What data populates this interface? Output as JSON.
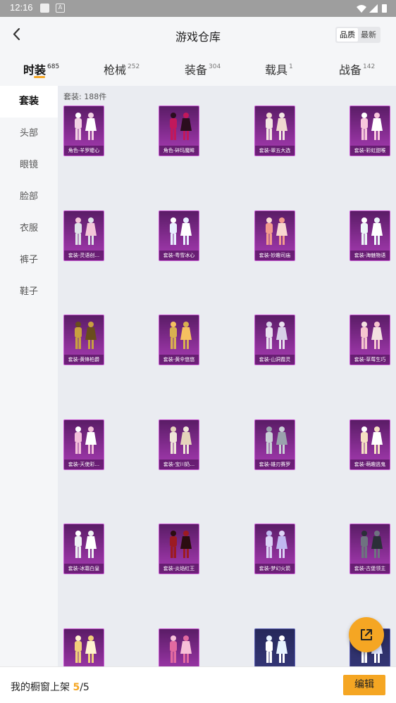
{
  "status_bar": {
    "time": "12:16"
  },
  "header": {
    "title": "游戏仓库",
    "sort_quality": "品质",
    "sort_latest": "最新"
  },
  "tabs": [
    {
      "label": "时装",
      "count": "685"
    },
    {
      "label": "枪械",
      "count": "252"
    },
    {
      "label": "装备",
      "count": "304"
    },
    {
      "label": "载具",
      "count": "1"
    },
    {
      "label": "战备",
      "count": "142"
    }
  ],
  "sidebar": {
    "items": [
      "套装",
      "头部",
      "眼镜",
      "脸部",
      "衣服",
      "裤子",
      "鞋子"
    ]
  },
  "content": {
    "count_label": "套装: 188件"
  },
  "items": [
    "角色-羊罗睫心",
    "角色-碎玛魔眸",
    "套装-翠五大选",
    "套装-彩虹甜喉",
    "套装-灵语创...",
    "套装-粤雪冰心",
    "套装-妙趣司庙",
    "套装-海魅物语",
    "套装-黄锋柏爵",
    "套装-黄伞悠悠",
    "套装-山洞霞灵",
    "套装-草莓生巧",
    "套装-天使彩...",
    "套装-宝川奶...",
    "套装-雄刃赛罗",
    "套装-萌趣逃鬼",
    "套装-冰霜白皇",
    "套装-炎焰红王",
    "套装-梦幻火箭",
    "套装-古堡领主",
    "",
    "",
    "",
    ""
  ],
  "bottom_bar": {
    "prefix": "我的橱窗上架",
    "current": "5",
    "sep": "/",
    "total": "5",
    "edit_label": "编辑"
  },
  "colors": {
    "accent": "#f5a623",
    "card_purple": "#8a2f96",
    "card_dark": "#383a7e"
  }
}
